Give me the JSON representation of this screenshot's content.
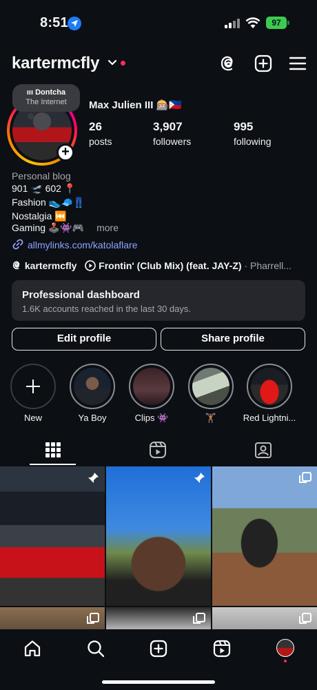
{
  "status_bar": {
    "time": "8:51",
    "battery": "97"
  },
  "header": {
    "username": "kartermcfly"
  },
  "profile": {
    "note_line1": "Dontcha",
    "note_line2": "The Internet",
    "display_name": "Max Julien III 🎰🇵🇭",
    "posts_count": "26",
    "posts_label": "posts",
    "followers_count": "3,907",
    "followers_label": "followers",
    "following_count": "995",
    "following_label": "following",
    "category": "Personal blog",
    "bio_lines": [
      "901 🛫 602 📍",
      "Fashion 👟🧢👖",
      "Nostalgia ⏮️",
      "Gaming 🕹️👾🎮"
    ],
    "more": "more",
    "link": "allmylinks.com/katolaflare",
    "threads_handle": "kartermcfly",
    "music_title": "Frontin' (Club Mix) (feat. JAY-Z)",
    "music_artist": "· Pharrell..."
  },
  "dashboard": {
    "title": "Professional dashboard",
    "subtitle": "1.6K accounts reached in the last 30 days."
  },
  "buttons": {
    "edit": "Edit profile",
    "share": "Share profile"
  },
  "highlights": [
    {
      "label": "New"
    },
    {
      "label": "Ya Boy"
    },
    {
      "label": "Clips 👾"
    },
    {
      "label": "🏋🏾"
    },
    {
      "label": "Red Lightni..."
    }
  ],
  "colors": {
    "background": "#0c0f14",
    "accent_link": "#8fa3ff",
    "notification": "#ff2d55",
    "battery": "#3ccb52"
  }
}
